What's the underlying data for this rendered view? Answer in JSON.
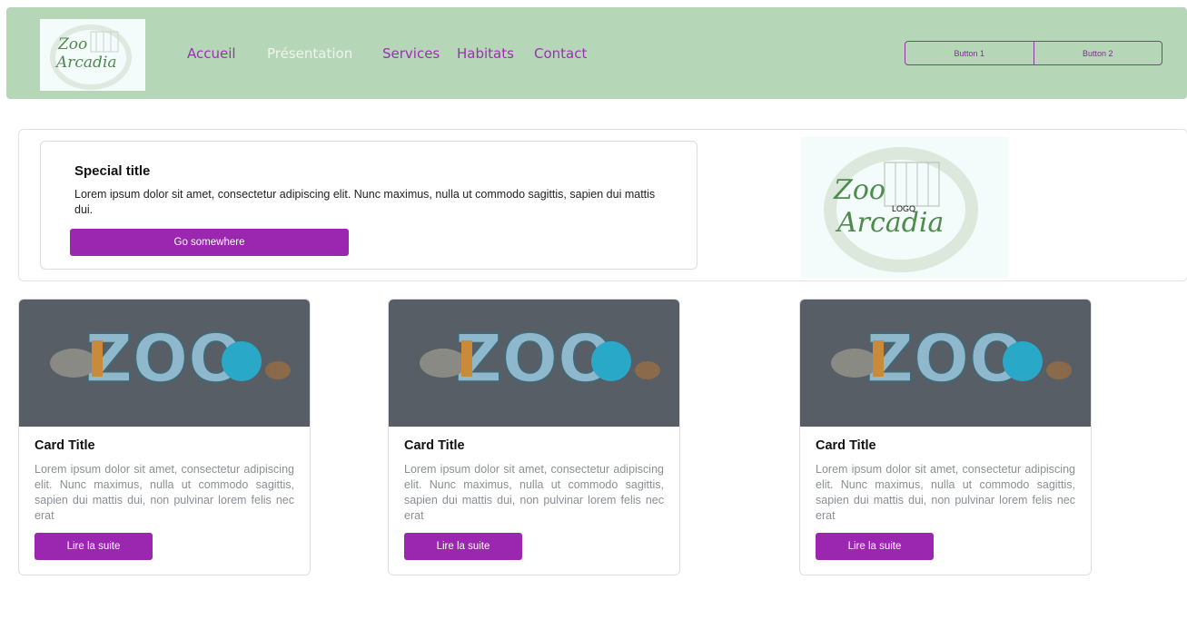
{
  "navbar": {
    "logo_text_line1": "Zoo",
    "logo_text_line2": "Arcadia",
    "links": [
      {
        "label": "Accueil",
        "active": false
      },
      {
        "label": "Présentation",
        "active": true
      },
      {
        "label": "Services",
        "active": false
      },
      {
        "label": "Habitats",
        "active": false
      },
      {
        "label": "Contact",
        "active": false
      }
    ],
    "buttons": [
      "Button 1",
      "Button 2"
    ]
  },
  "hero": {
    "title": "Special title",
    "text": "Lorem ipsum dolor sit amet, consectetur adipiscing elit. Nunc maximus, nulla ut commodo sagittis, sapien dui mattis dui.",
    "button_label": "Go somewhere",
    "logo_text_line1": "Zoo",
    "logo_text_line2": "Arcadia",
    "logo_caption": "LOGO"
  },
  "cards": [
    {
      "image_text": "ZOO",
      "title": "Card Title",
      "text": "Lorem ipsum dolor sit amet, consectetur adipiscing elit. Nunc maximus, nulla ut commodo sagittis, sapien dui mattis dui, non pulvinar lorem felis nec erat",
      "button_label": "Lire la suite"
    },
    {
      "image_text": "ZOO",
      "title": "Card Title",
      "text": "Lorem ipsum dolor sit amet, consectetur adipiscing elit. Nunc maximus, nulla ut commodo sagittis, sapien dui mattis dui, non pulvinar lorem felis nec erat",
      "button_label": "Lire la suite"
    },
    {
      "image_text": "ZOO",
      "title": "Card Title",
      "text": "Lorem ipsum dolor sit amet, consectetur adipiscing elit. Nunc maximus, nulla ut commodo sagittis, sapien dui mattis dui, non pulvinar lorem felis nec erat",
      "button_label": "Lire la suite"
    }
  ],
  "colors": {
    "navbar_bg": "#b5d7b8",
    "accent_purple": "#9b27b0",
    "card_image_bg": "#575e66"
  }
}
